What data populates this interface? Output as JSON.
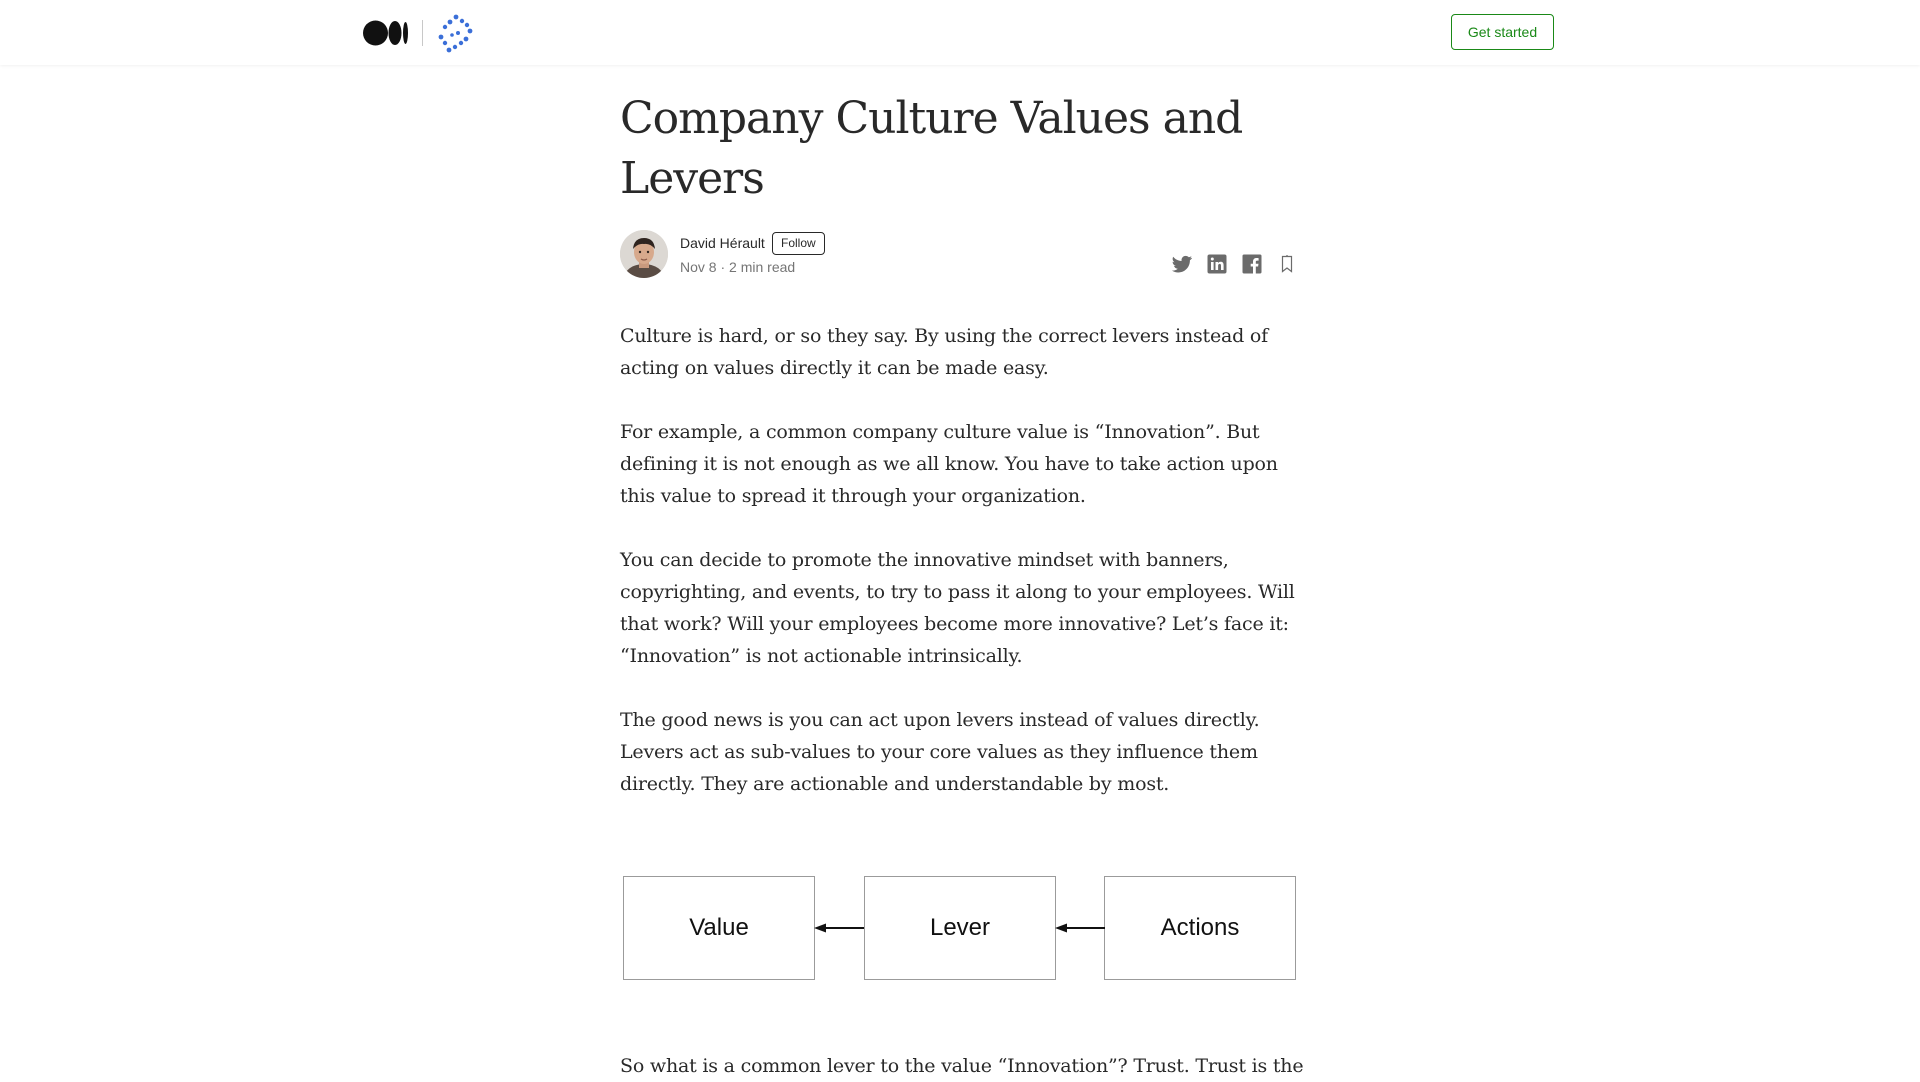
{
  "header": {
    "logo_icon": "medium-logo-icon",
    "publication_icon": "publication-logo-icon",
    "get_started_label": "Get started"
  },
  "article": {
    "title": "Company Culture Values and Levers",
    "author": {
      "name": "David Hérault",
      "follow_label": "Follow",
      "date": "Nov 8",
      "separator": "·",
      "read_time": "2 min read"
    },
    "share_icons": [
      "twitter-icon",
      "linkedin-icon",
      "facebook-icon",
      "bookmark-icon"
    ],
    "paragraphs": [
      "Culture is hard, or so they say. By using the correct levers instead of acting on values directly it can be made easy.",
      "For example, a common company culture value is “Innovation”. But defining it is not enough as we all know. You have to take action upon this value to spread it through your organization.",
      "You can decide to promote the innovative mindset with banners, copyrighting, and events, to try to pass it along to your employees. Will that work? Will your employees become more innovative? Let’s face it: “Innovation” is not actionable intrinsically.",
      "The good news is you can act upon levers instead of values directly. Levers act as sub-values to your core values as they influence them directly. They are actionable and understandable by most."
    ],
    "diagram": {
      "boxes": [
        "Value",
        "Lever",
        "Actions"
      ]
    },
    "trailing_paragraph": "So what is a common lever to the value “Innovation”? Trust. Trust is the"
  },
  "colors": {
    "accent_green": "#1a8917",
    "text": "#292929",
    "muted": "#757575",
    "publication_blue": "#3b6fd8"
  }
}
